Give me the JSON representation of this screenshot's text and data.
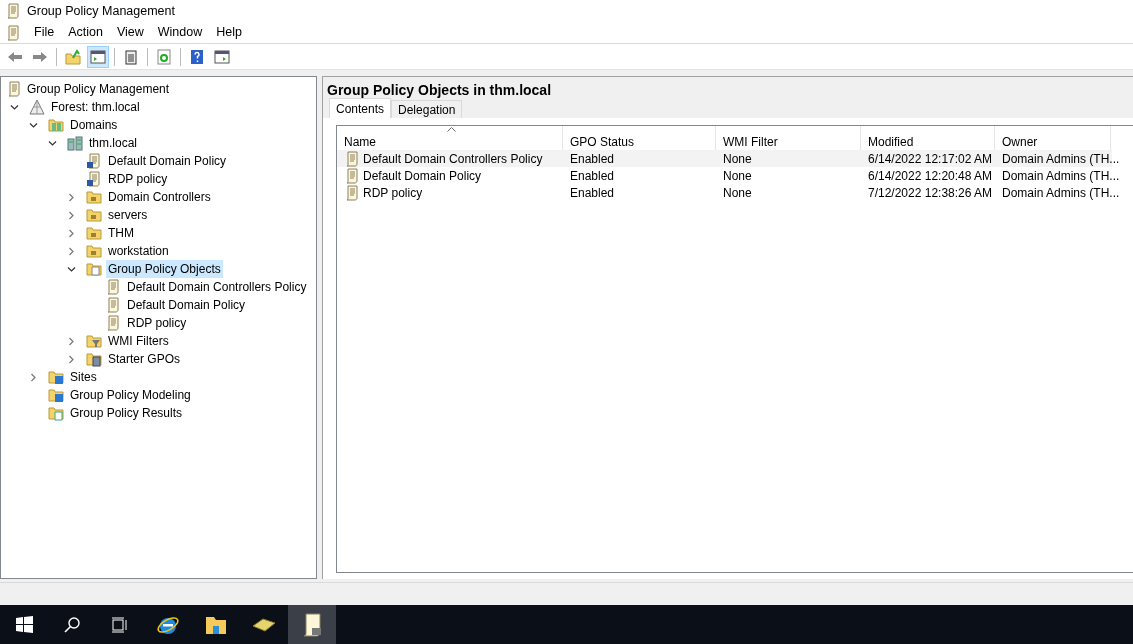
{
  "window": {
    "title": "Group Policy Management"
  },
  "menu": [
    "File",
    "Action",
    "View",
    "Window",
    "Help"
  ],
  "tree": [
    {
      "label": "Group Policy Management",
      "kind": "console",
      "selected": false,
      "children": [
        {
          "label": "Forest: thm.local",
          "kind": "forest",
          "expanded": true,
          "selected": false,
          "children": [
            {
              "label": "Domains",
              "kind": "domains",
              "expanded": true,
              "selected": false,
              "children": [
                {
                  "label": "thm.local",
                  "kind": "domain",
                  "expanded": true,
                  "selected": false,
                  "children": [
                    {
                      "label": "Default Domain Policy",
                      "kind": "link",
                      "selected": false
                    },
                    {
                      "label": "RDP policy",
                      "kind": "link",
                      "selected": false
                    },
                    {
                      "label": "Domain Controllers",
                      "kind": "ou",
                      "expanded": false,
                      "selected": false
                    },
                    {
                      "label": "servers",
                      "kind": "ou",
                      "expanded": false,
                      "selected": false
                    },
                    {
                      "label": "THM",
                      "kind": "ou",
                      "expanded": false,
                      "selected": false
                    },
                    {
                      "label": "workstation",
                      "kind": "ou",
                      "expanded": false,
                      "selected": false
                    },
                    {
                      "label": "Group Policy Objects",
                      "kind": "folder",
                      "expanded": true,
                      "selected": true,
                      "children": [
                        {
                          "label": "Default Domain Controllers Policy",
                          "kind": "gpo",
                          "selected": false
                        },
                        {
                          "label": "Default Domain Policy",
                          "kind": "gpo",
                          "selected": false
                        },
                        {
                          "label": "RDP policy",
                          "kind": "gpo",
                          "selected": false
                        }
                      ]
                    },
                    {
                      "label": "WMI Filters",
                      "kind": "filter",
                      "expanded": false,
                      "selected": false
                    },
                    {
                      "label": "Starter GPOs",
                      "kind": "starter",
                      "expanded": false,
                      "selected": false
                    }
                  ]
                }
              ]
            },
            {
              "label": "Sites",
              "kind": "sites",
              "expanded": false,
              "selected": false
            },
            {
              "label": "Group Policy Modeling",
              "kind": "modeling",
              "selected": false
            },
            {
              "label": "Group Policy Results",
              "kind": "results",
              "selected": false
            }
          ]
        }
      ]
    }
  ],
  "details": {
    "title": "Group Policy Objects in thm.local",
    "tabs": [
      {
        "label": "Contents",
        "selected": true
      },
      {
        "label": "Delegation",
        "selected": false
      }
    ],
    "columns": [
      "Name",
      "GPO Status",
      "WMI Filter",
      "Modified",
      "Owner"
    ],
    "rows": [
      {
        "cells": [
          "Default Domain Controllers Policy",
          "Enabled",
          "None",
          "6/14/2022 12:17:02 AM",
          "Domain Admins (TH..."
        ],
        "selected": true
      },
      {
        "cells": [
          "Default Domain Policy",
          "Enabled",
          "None",
          "6/14/2022 12:20:48 AM",
          "Domain Admins (TH..."
        ],
        "selected": false
      },
      {
        "cells": [
          "RDP policy",
          "Enabled",
          "None",
          "7/12/2022 12:38:26 AM",
          "Domain Admins (TH..."
        ],
        "selected": false
      }
    ]
  }
}
